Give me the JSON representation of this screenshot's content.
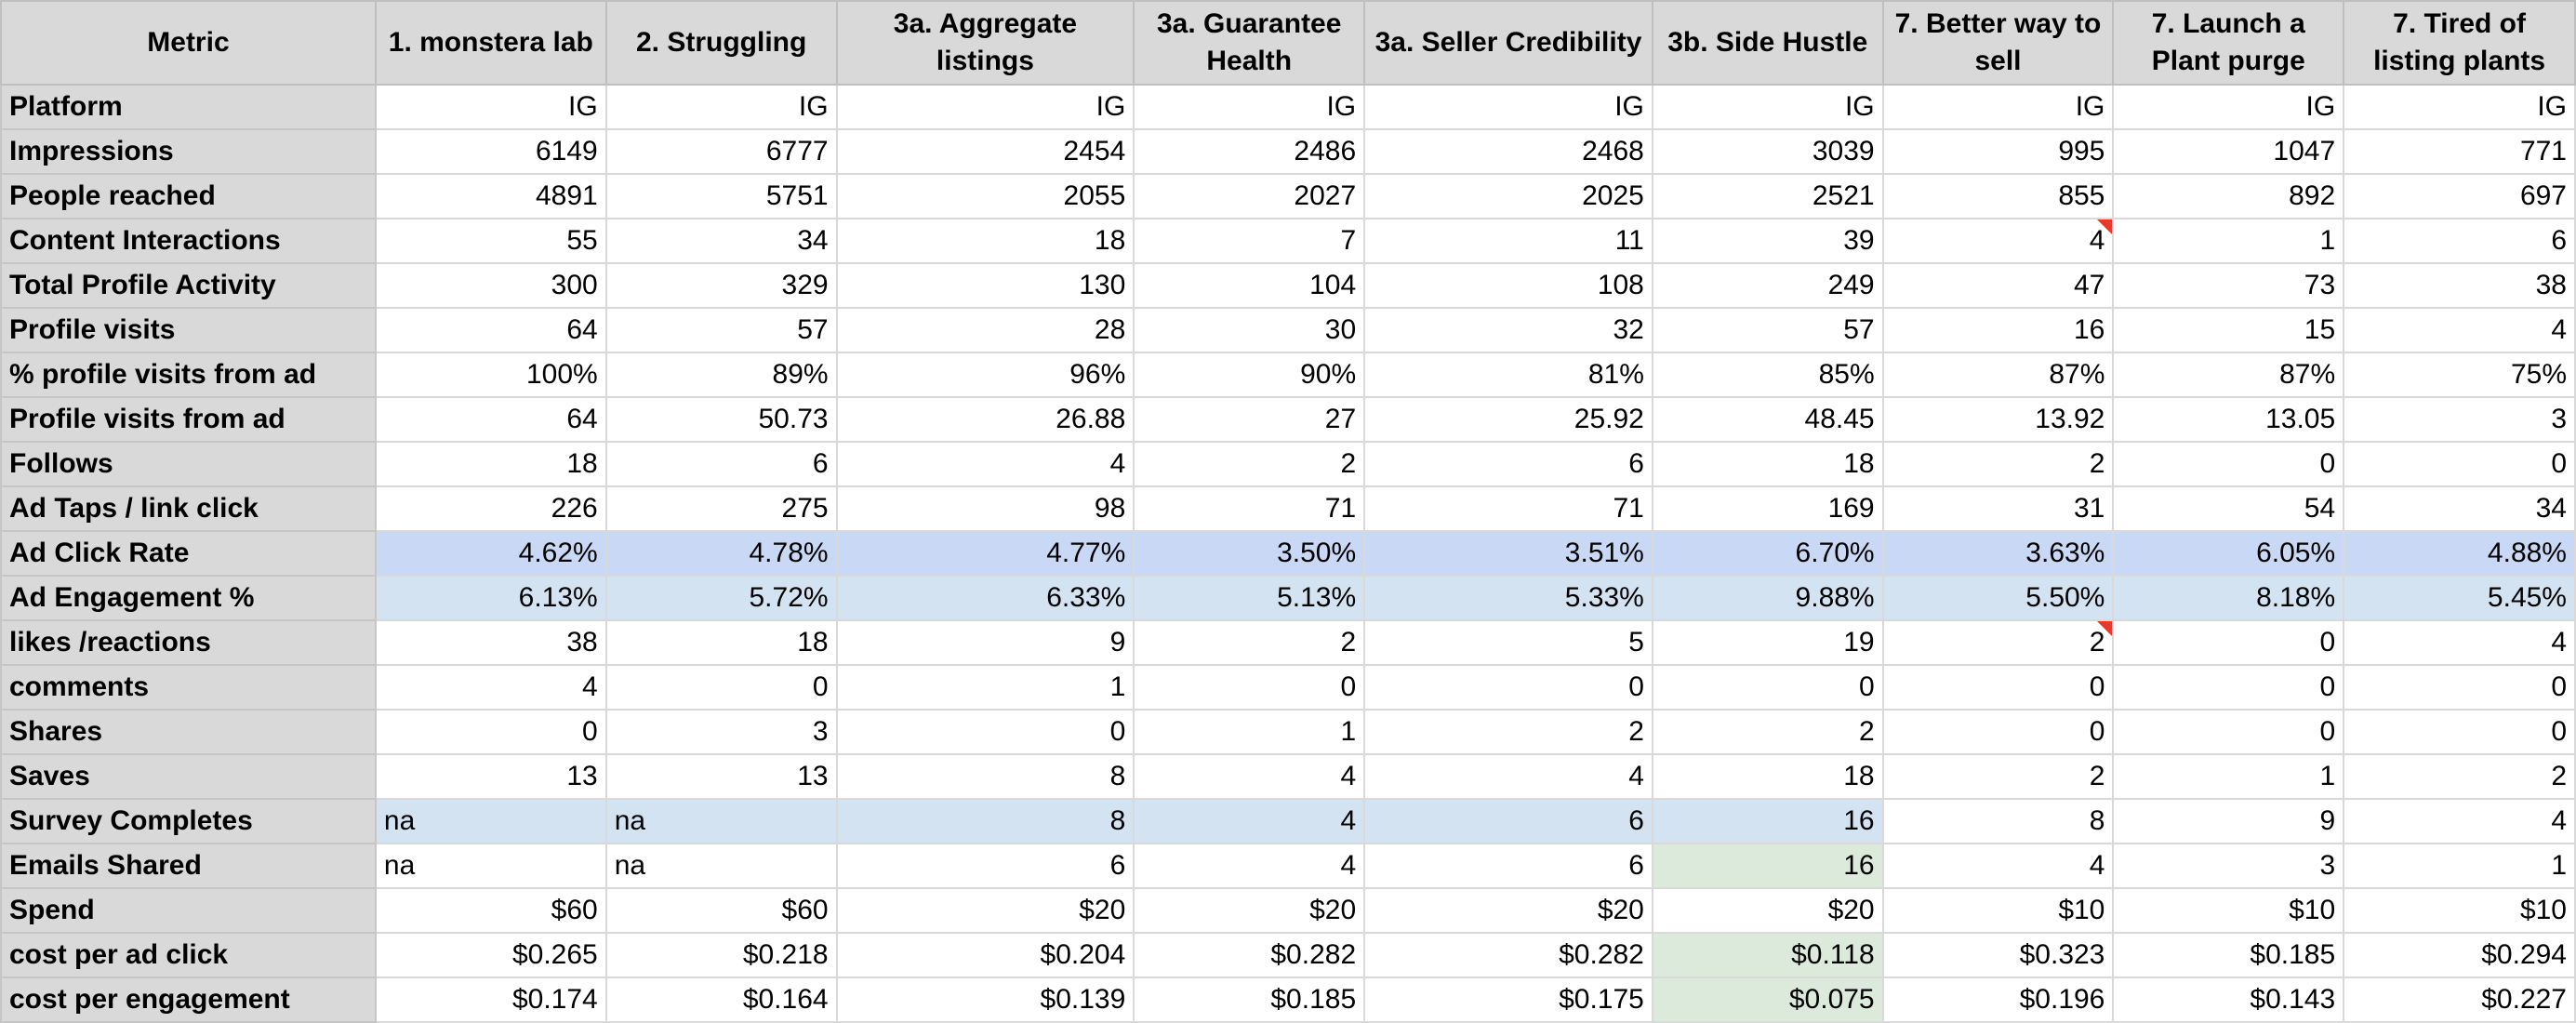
{
  "table": {
    "headers": [
      "Metric",
      "1. monstera lab",
      "2. Struggling",
      "3a. Aggregate listings",
      "3a. Guarantee Health",
      "3a. Seller Credibility",
      "3b. Side Hustle",
      "7. Better way to sell",
      "7. Launch a Plant purge",
      "7. Tired of listing plants"
    ],
    "rows": [
      {
        "label": "Platform",
        "cells": [
          "IG",
          "IG",
          "IG",
          "IG",
          "IG",
          "IG",
          "IG",
          "IG",
          "IG"
        ]
      },
      {
        "label": "Impressions",
        "cells": [
          "6149",
          "6777",
          "2454",
          "2486",
          "2468",
          "3039",
          "995",
          "1047",
          "771"
        ]
      },
      {
        "label": "People reached",
        "cells": [
          "4891",
          "5751",
          "2055",
          "2027",
          "2025",
          "2521",
          "855",
          "892",
          "697"
        ]
      },
      {
        "label": "Content Interactions",
        "cells": [
          "55",
          "34",
          "18",
          "7",
          "11",
          "39",
          "4",
          "1",
          "6"
        ]
      },
      {
        "label": "Total Profile Activity",
        "cells": [
          "300",
          "329",
          "130",
          "104",
          "108",
          "249",
          "47",
          "73",
          "38"
        ]
      },
      {
        "label": "Profile visits",
        "cells": [
          "64",
          "57",
          "28",
          "30",
          "32",
          "57",
          "16",
          "15",
          "4"
        ]
      },
      {
        "label": "% profile visits from ad",
        "cells": [
          "100%",
          "89%",
          "96%",
          "90%",
          "81%",
          "85%",
          "87%",
          "87%",
          "75%"
        ]
      },
      {
        "label": "Profile visits from ad",
        "cells": [
          "64",
          "50.73",
          "26.88",
          "27",
          "25.92",
          "48.45",
          "13.92",
          "13.05",
          "3"
        ]
      },
      {
        "label": "Follows",
        "cells": [
          "18",
          "6",
          "4",
          "2",
          "6",
          "18",
          "2",
          "0",
          "0"
        ]
      },
      {
        "label": "Ad Taps / link click",
        "cells": [
          "226",
          "275",
          "98",
          "71",
          "71",
          "169",
          "31",
          "54",
          "34"
        ]
      },
      {
        "label": "Ad Click Rate",
        "cells": [
          "4.62%",
          "4.78%",
          "4.77%",
          "3.50%",
          "3.51%",
          "6.70%",
          "3.63%",
          "6.05%",
          "4.88%"
        ]
      },
      {
        "label": "Ad Engagement %",
        "cells": [
          "6.13%",
          "5.72%",
          "6.33%",
          "5.13%",
          "5.33%",
          "9.88%",
          "5.50%",
          "8.18%",
          "5.45%"
        ]
      },
      {
        "label": "likes /reactions",
        "cells": [
          "38",
          "18",
          "9",
          "2",
          "5",
          "19",
          "2",
          "0",
          "4"
        ]
      },
      {
        "label": "comments",
        "cells": [
          "4",
          "0",
          "1",
          "0",
          "0",
          "0",
          "0",
          "0",
          "0"
        ]
      },
      {
        "label": "Shares",
        "cells": [
          "0",
          "3",
          "0",
          "1",
          "2",
          "2",
          "0",
          "0",
          "0"
        ]
      },
      {
        "label": "Saves",
        "cells": [
          "13",
          "13",
          "8",
          "4",
          "4",
          "18",
          "2",
          "1",
          "2"
        ]
      },
      {
        "label": "Survey Completes",
        "cells": [
          "na",
          "na",
          "8",
          "4",
          "6",
          "16",
          "8",
          "9",
          "4"
        ]
      },
      {
        "label": "Emails Shared",
        "cells": [
          "na",
          "na",
          "6",
          "4",
          "6",
          "16",
          "4",
          "3",
          "1"
        ]
      },
      {
        "label": "Spend",
        "cells": [
          "$60",
          "$60",
          "$20",
          "$20",
          "$20",
          "$20",
          "$10",
          "$10",
          "$10"
        ]
      },
      {
        "label": "cost per ad click",
        "cells": [
          "$0.265",
          "$0.218",
          "$0.204",
          "$0.282",
          "$0.282",
          "$0.118",
          "$0.323",
          "$0.185",
          "$0.294"
        ]
      },
      {
        "label": "cost per engagement",
        "cells": [
          "$0.174",
          "$0.164",
          "$0.139",
          "$0.185",
          "$0.175",
          "$0.075",
          "$0.196",
          "$0.143",
          "$0.227"
        ]
      }
    ]
  },
  "colors": {
    "header_fill": "#d9d9d9",
    "highlight_blue_strong": "#c9d8f5",
    "highlight_blue_light": "#d3e3f2",
    "highlight_green": "#dceadc",
    "comment_marker": "#e53b2c"
  }
}
